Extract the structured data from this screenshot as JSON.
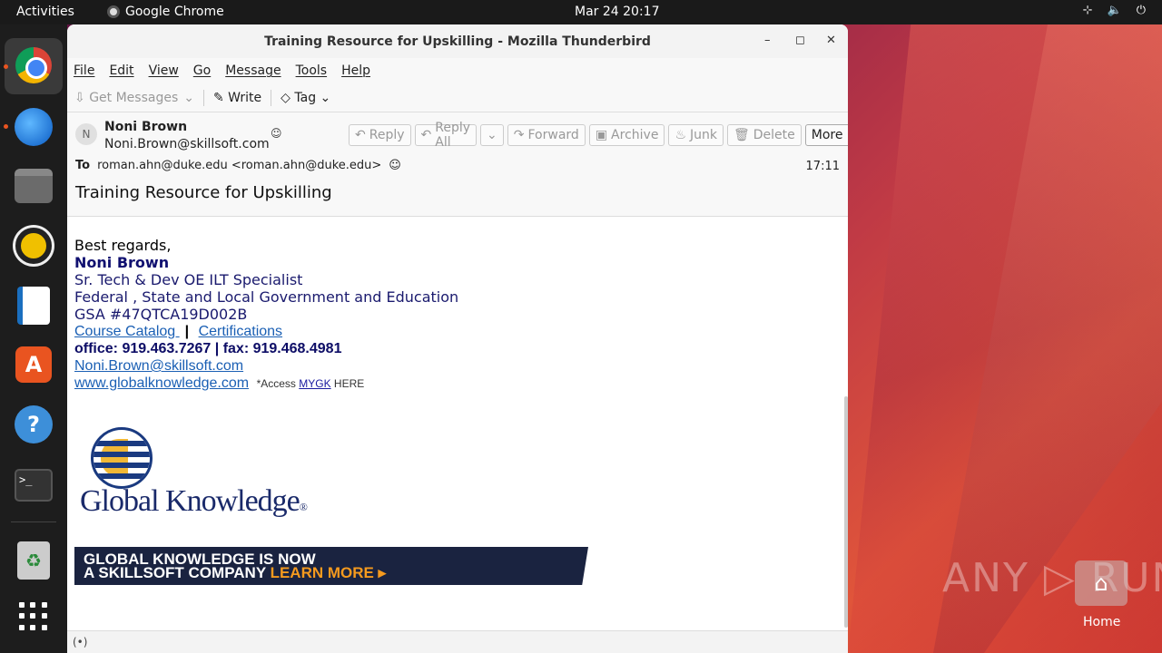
{
  "topbar": {
    "activities": "Activities",
    "app_name": "Google Chrome",
    "clock": "Mar 24  20:17"
  },
  "window": {
    "title": "Training Resource for Upskilling - Mozilla Thunderbird",
    "controls": {
      "minimize": "–",
      "maximize": "◻",
      "close": "✕"
    }
  },
  "menu": [
    "File",
    "Edit",
    "View",
    "Go",
    "Message",
    "Tools",
    "Help"
  ],
  "toolbar": {
    "get_messages": "Get Messages",
    "write": "Write",
    "tag": "Tag"
  },
  "message": {
    "avatar_letter": "N",
    "from_name": "Noni Brown",
    "from_email": "Noni.Brown@skillsoft.com",
    "to_label": "To",
    "to_value": "roman.ahn@duke.edu <roman.ahn@duke.edu>",
    "time": "17:11",
    "subject": "Training Resource for Upskilling",
    "actions": {
      "reply": "Reply",
      "reply_all": "Reply All",
      "forward": "Forward",
      "archive": "Archive",
      "junk": "Junk",
      "delete": "Delete",
      "more": "More"
    }
  },
  "body": {
    "regards": "Best regards,",
    "name": "Noni Brown",
    "title": "Sr. Tech & Dev OE ILT Specialist",
    "dept": "Federal , State and Local Government and Education",
    "gsa": "GSA #47QTCA19D002B",
    "course_catalog": "Course Catalog ",
    "separator": "|",
    "certifications": "Certifications ",
    "phone": "office: 919.463.7267  |  fax: 919.468.4981",
    "email": "Noni.Brown@skillsoft.com",
    "website": "www.globalknowledge.com",
    "access_pre": "*Access ",
    "access_link": "MYGK",
    "access_post": " HERE",
    "logo_text": "Global Knowledge",
    "logo_mark": "®",
    "banner_line1": "GLOBAL KNOWLEDGE IS NOW",
    "banner_line2_a": "A SKILLSOFT COMPANY ",
    "banner_line2_b": "LEARN MORE ▸"
  },
  "statusbar": {
    "icon": "(•)"
  },
  "desktop": {
    "watermark": "ANY ▷ RUN",
    "home_label": "Home"
  }
}
